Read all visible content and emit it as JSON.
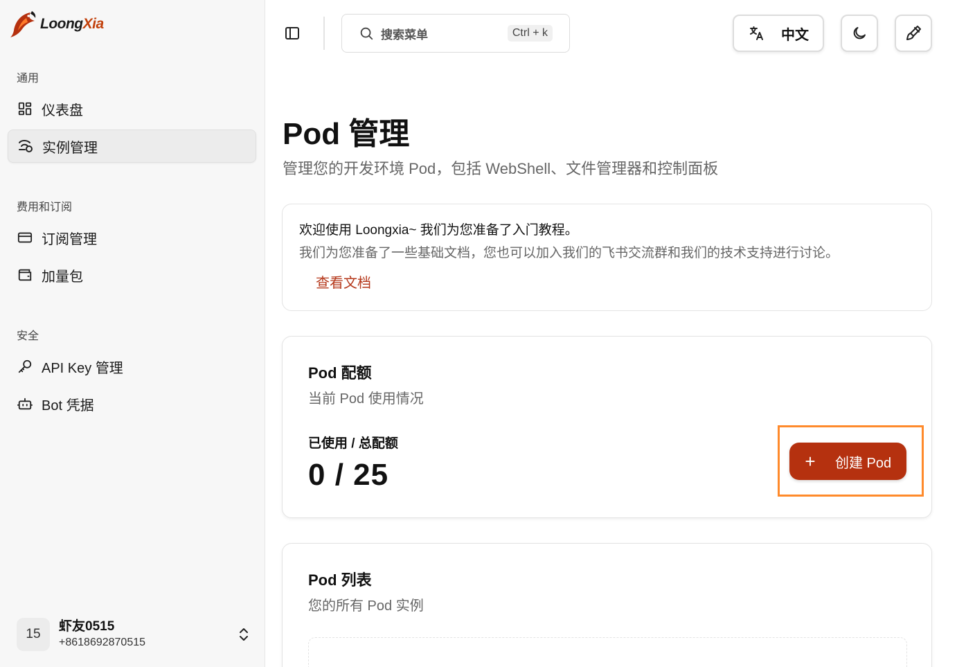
{
  "brand": {
    "name_part1": "Loong",
    "name_part2": "Xia"
  },
  "sidebar": {
    "sections": [
      {
        "label": "通用",
        "items": [
          {
            "label": "仪表盘",
            "icon": "dashboard-icon"
          },
          {
            "label": "实例管理",
            "icon": "instance-icon",
            "active": true
          }
        ]
      },
      {
        "label": "费用和订阅",
        "items": [
          {
            "label": "订阅管理",
            "icon": "credit-card-icon"
          },
          {
            "label": "加量包",
            "icon": "wallet-icon"
          }
        ]
      },
      {
        "label": "安全",
        "items": [
          {
            "label": "API Key 管理",
            "icon": "key-icon"
          },
          {
            "label": "Bot 凭据",
            "icon": "bot-icon"
          }
        ]
      }
    ],
    "user": {
      "avatar": "15",
      "name": "虾友0515",
      "phone": "+8618692870515"
    }
  },
  "topbar": {
    "search_placeholder": "搜索菜单",
    "search_shortcut": "Ctrl + k",
    "language": "中文"
  },
  "page": {
    "title": "Pod 管理",
    "subtitle": "管理您的开发环境 Pod，包括 WebShell、文件管理器和控制面板"
  },
  "welcome": {
    "title": "欢迎使用 Loongxia~ 我们为您准备了入门教程。",
    "text": "我们为您准备了一些基础文档，您也可以加入我们的飞书交流群和我们的技术支持进行讨论。",
    "link": "查看文档"
  },
  "quota": {
    "title": "Pod 配额",
    "desc": "当前 Pod 使用情况",
    "usage_label": "已使用 / 总配额",
    "usage_value": "0 / 25",
    "create_button": "创建 Pod"
  },
  "pod_list": {
    "title": "Pod 列表",
    "desc": "您的所有 Pod 实例"
  },
  "colors": {
    "accent": "#b5310f",
    "highlight": "#ff8a2b"
  }
}
